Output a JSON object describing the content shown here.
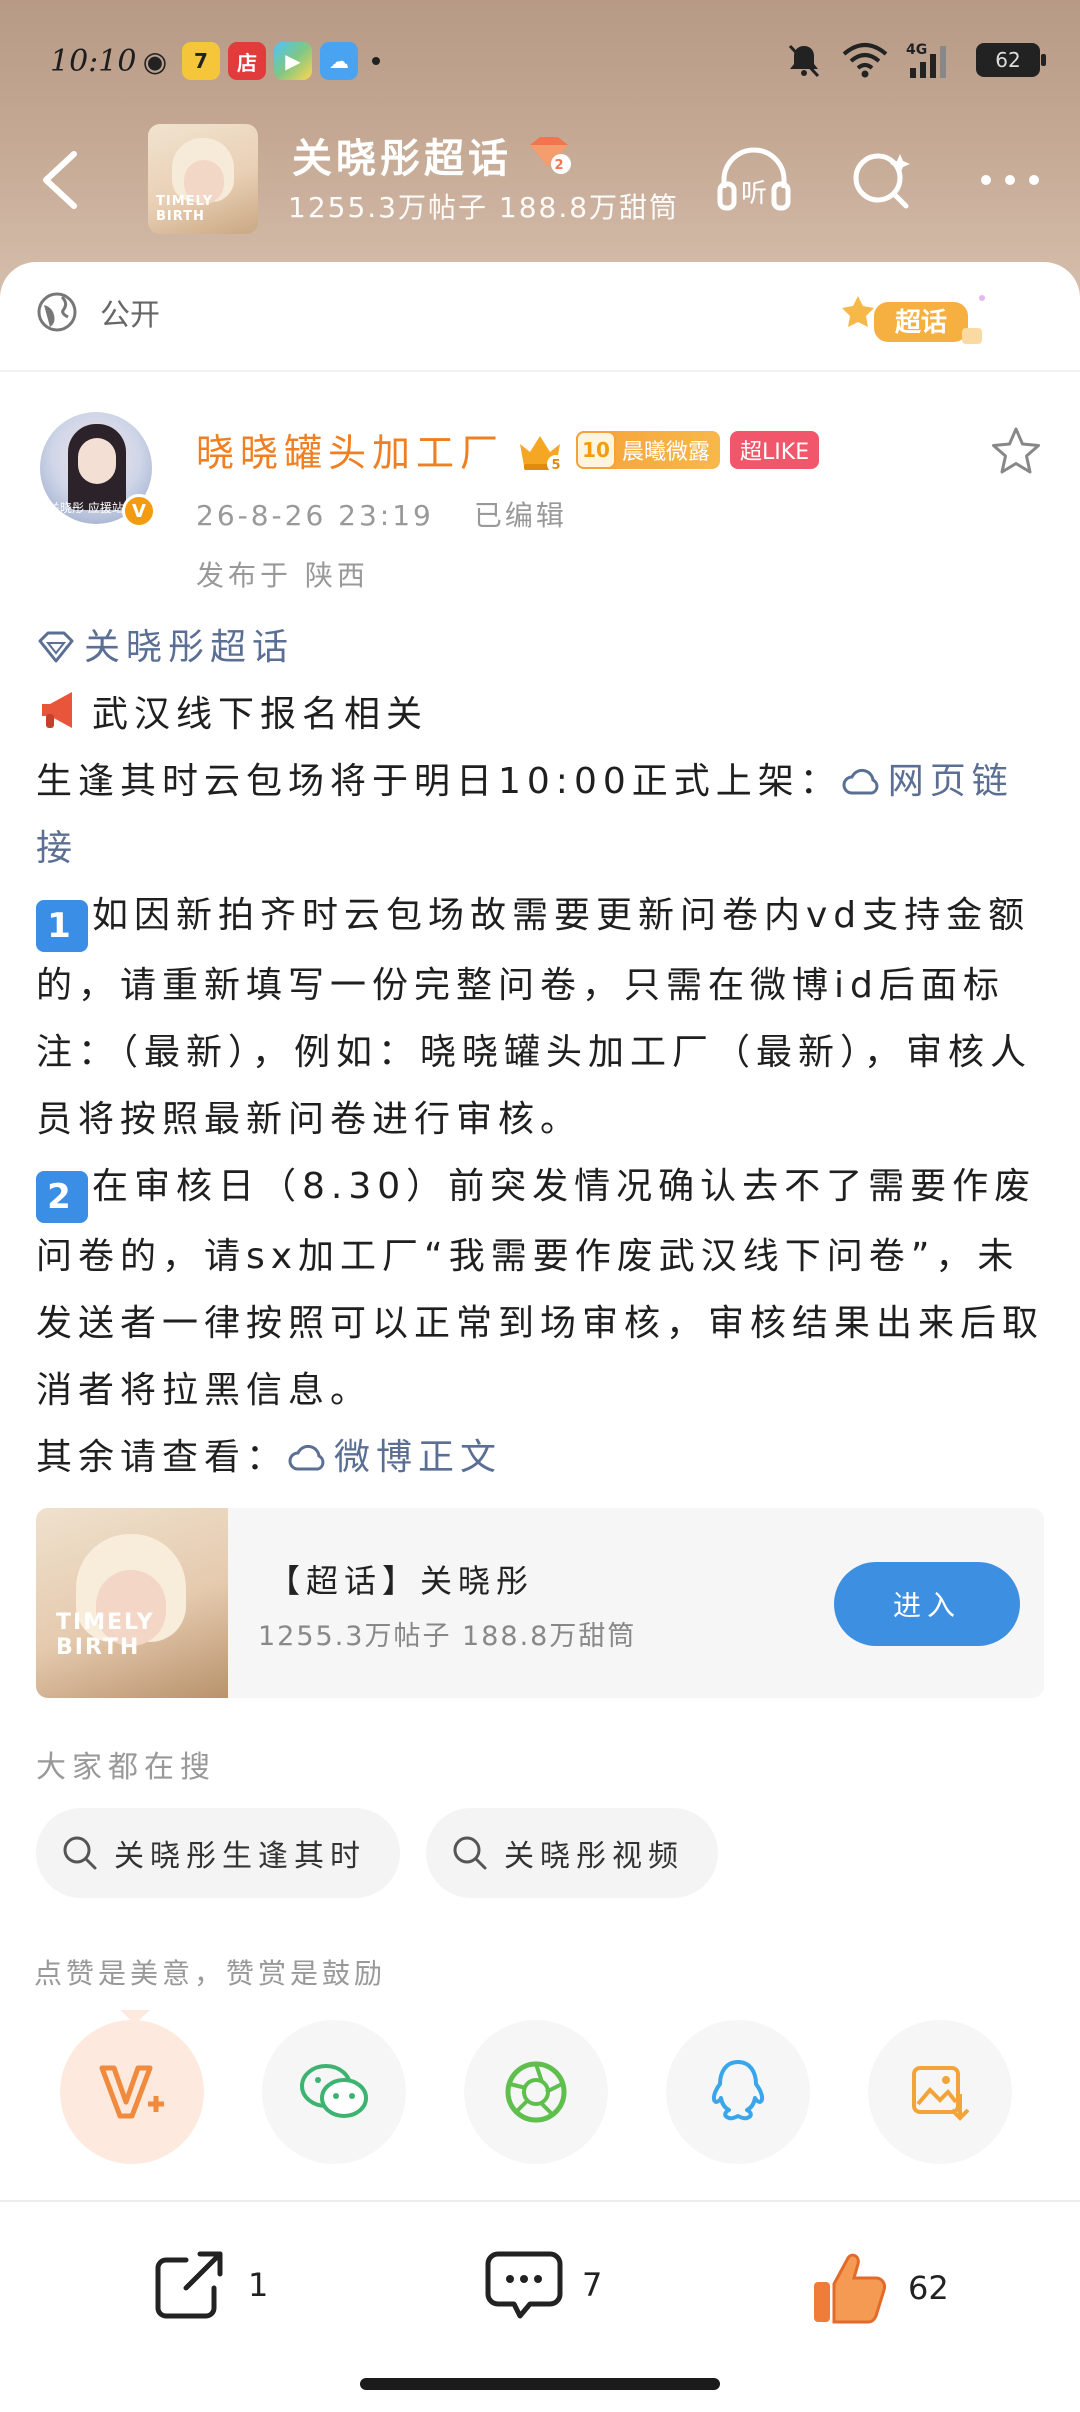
{
  "status_bar": {
    "time": "10:10",
    "battery": "62",
    "network": "4G"
  },
  "nav": {
    "cover_text": "TIMELY BIRTH",
    "title": "关晓彤超话",
    "level": "2",
    "subtitle": "1255.3万帖子 188.8万甜筒",
    "listen_label": "听"
  },
  "post": {
    "visibility": "公开",
    "chaohua_badge": "超话",
    "author": {
      "name": "晓晓罐头加工厂",
      "crown_level": "5",
      "fan_level": "10",
      "fan_badge": "晨曦微露",
      "like_badge": "超LIKE",
      "avatar_caption": "关晓彤 应援站"
    },
    "date": "26-8-26 23:19",
    "edited": "已编辑",
    "location": "发布于 陕西",
    "topic": "关晓彤超话",
    "lines": {
      "heading": "武汉线下报名相关",
      "l1": "生逢其时云包场将于明日10:00正式上架：",
      "l1_link": "网页链接",
      "p1": "如因新拍齐时云包场故需要更新问卷内vd支持金额的，请重新填写一份完整问卷，只需在微博id后面标注：（最新），例如：晓晓罐头加工厂（最新），审核人员将按照最新问卷进行审核。",
      "p2": "在审核日（8.30）前突发情况确认去不了需要作废问卷的，请sx加工厂“我需要作废武汉线下问卷”，未发送者一律按照可以正常到场审核，审核结果出来后取消者将拉黑信息。",
      "tail": "其余请查看：",
      "tail_link": "微博正文",
      "num1": "1",
      "num2": "2"
    }
  },
  "super_card": {
    "cover_text": "TIMELY BIRTH",
    "title": "【超话】关晓彤",
    "stats": "1255.3万帖子 188.8万甜筒",
    "button": "进入"
  },
  "search": {
    "label": "大家都在搜",
    "chips": [
      "关晓彤生逢其时",
      "关晓彤视频"
    ]
  },
  "tip": "点赞是美意，赞赏是鼓励",
  "share_targets": [
    "reward",
    "wechat",
    "moments",
    "qq",
    "save-image"
  ],
  "actions": {
    "repost": "1",
    "comment": "7",
    "like": "62"
  },
  "colors": {
    "accent_blue": "#3d8fe2",
    "author_orange": "#f07f22",
    "link": "#5a6f93",
    "like_orange": "#f08a3c"
  }
}
